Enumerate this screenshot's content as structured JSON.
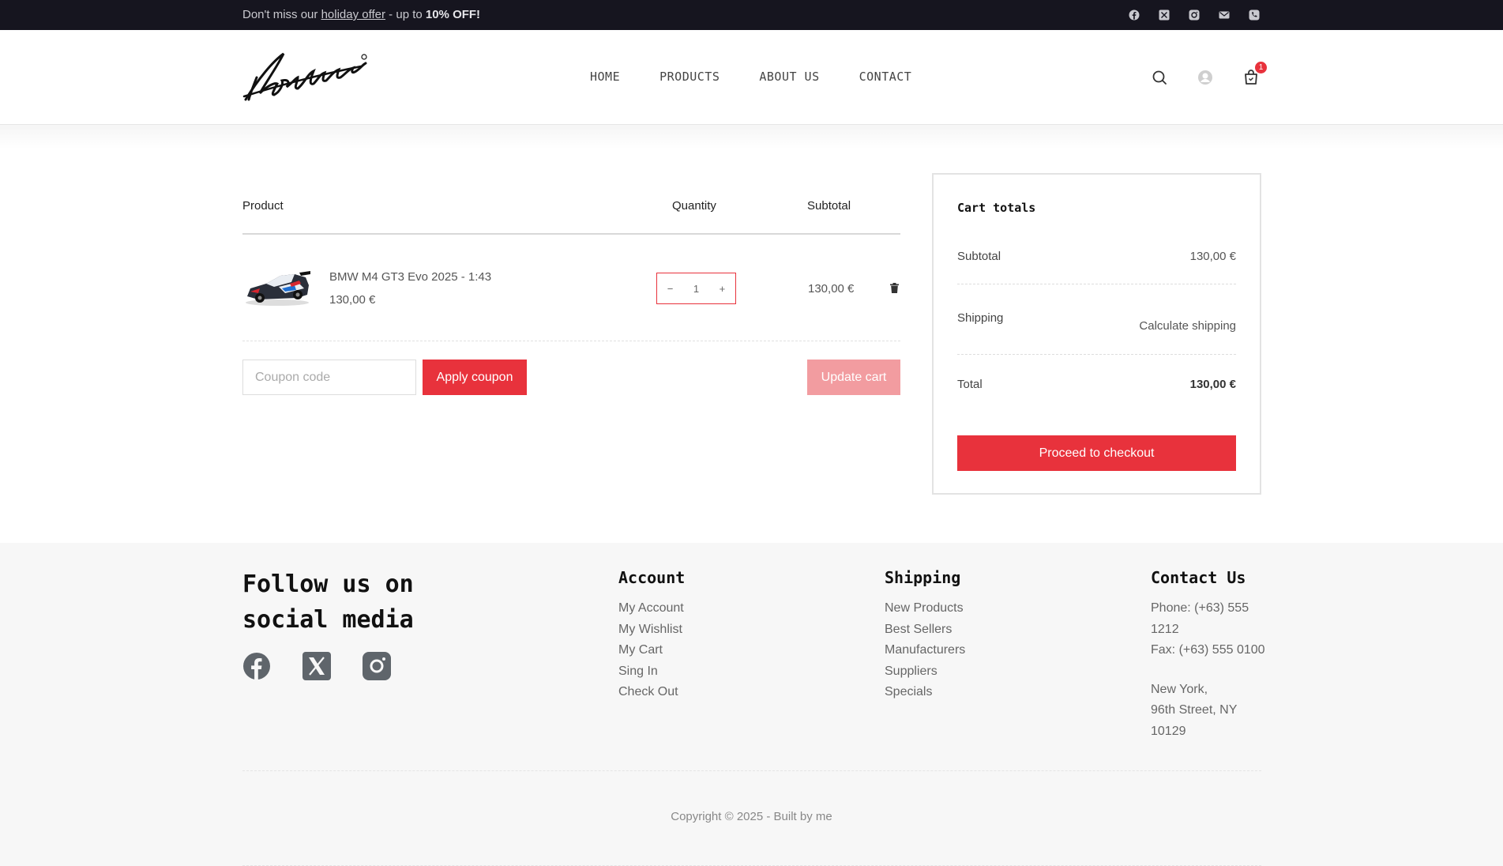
{
  "topbar": {
    "prefix": "Don't miss our ",
    "offer_link": "holiday offer",
    "middle": " - up to ",
    "discount": "10% OFF!",
    "socials": [
      "facebook-icon",
      "x-icon",
      "instagram-icon",
      "mail-icon",
      "phone-icon"
    ]
  },
  "nav": {
    "home": "HOME",
    "products": "PRODUCTS",
    "about": "ABOUT US",
    "contact": "CONTACT"
  },
  "header": {
    "cart_count": "1"
  },
  "cart": {
    "col_product": "Product",
    "col_quantity": "Quantity",
    "col_subtotal": "Subtotal",
    "item": {
      "name": "BMW M4 GT3 Evo 2025 - 1:43",
      "price": "130,00 €",
      "minus": "−",
      "quantity": "1",
      "plus": "+",
      "subtotal": "130,00 €"
    },
    "coupon_placeholder": "Coupon code",
    "apply_label": "Apply coupon",
    "update_label": "Update cart"
  },
  "totals": {
    "title": "Cart totals",
    "subtotal_label": "Subtotal",
    "subtotal_value": "130,00 €",
    "shipping_label": "Shipping",
    "shipping_value": "Calculate shipping",
    "total_label": "Total",
    "total_value": "130,00 €",
    "checkout_label": "Proceed to checkout"
  },
  "footer": {
    "follow_title": "Follow us on social media",
    "socials": [
      "facebook-icon",
      "x-icon",
      "instagram-icon"
    ],
    "account": {
      "title": "Account",
      "links": [
        "My Account",
        "My Wishlist",
        "My Cart",
        "Sing In",
        "Check Out"
      ]
    },
    "shipping": {
      "title": "Shipping",
      "links": [
        "New Products",
        "Best Sellers",
        "Manufacturers",
        "Suppliers",
        "Specials"
      ]
    },
    "contact": {
      "title": "Contact Us",
      "phone_1": "Phone: (+63) 555",
      "phone_2": "1212",
      "fax": "Fax: (+63) 555 0100",
      "addr_1": "New York,",
      "addr_2": "96th Street, NY",
      "addr_3": "10129"
    },
    "copyright": "Copyright © 2025 - Built by me"
  },
  "colors": {
    "accent": "#e8323c",
    "accent_light": "#f29ca0",
    "topbar_bg": "#16151f",
    "footer_bg": "#f7f7f7"
  }
}
